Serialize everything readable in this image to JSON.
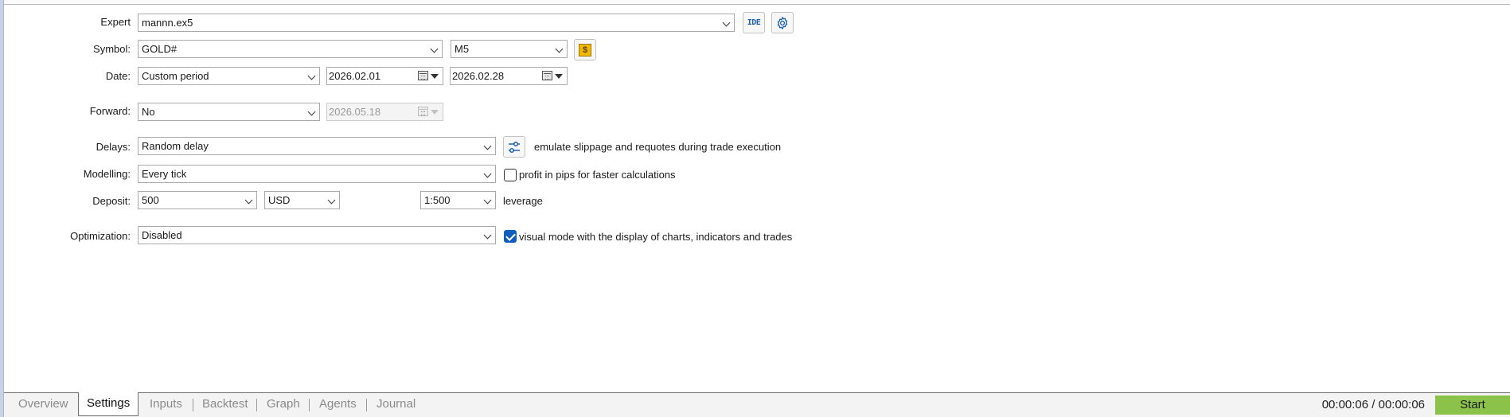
{
  "expert": {
    "label": "Expert",
    "value": "mannn.ex5",
    "ide_label": "IDE"
  },
  "symbol": {
    "label": "Symbol:",
    "value": "GOLD#",
    "timeframe": "M5"
  },
  "date": {
    "label": "Date:",
    "period": "Custom period",
    "from": "2026.02.01",
    "to": "2026.02.28"
  },
  "forward": {
    "label": "Forward:",
    "value": "No",
    "date": "2026.05.18"
  },
  "delays": {
    "label": "Delays:",
    "value": "Random delay",
    "description": "emulate slippage and requotes during trade execution"
  },
  "modelling": {
    "label": "Modelling:",
    "value": "Every tick",
    "checkbox_label": "profit in pips for faster calculations",
    "checked": false
  },
  "deposit": {
    "label": "Deposit:",
    "amount": "500",
    "currency": "USD",
    "leverage": "1:500",
    "leverage_label": "leverage"
  },
  "optimization": {
    "label": "Optimization:",
    "value": "Disabled",
    "checkbox_label": "visual mode with the display of charts, indicators and trades",
    "checked": true
  },
  "tabs": [
    {
      "label": "Overview"
    },
    {
      "label": "Settings"
    },
    {
      "label": "Inputs"
    },
    {
      "label": "Backtest"
    },
    {
      "label": "Graph"
    },
    {
      "label": "Agents"
    },
    {
      "label": "Journal"
    }
  ],
  "active_tab": "Settings",
  "timer": "00:00:06 / 00:00:06",
  "start_label": "Start",
  "colors": {
    "accent": "#0f5dc0",
    "start": "#8bc34a",
    "symbol_icon": "#f2b800"
  },
  "icons": [
    "gear-icon",
    "dollar-icon",
    "slider-settings-icon",
    "calendar-icon",
    "chevron-down-icon"
  ]
}
